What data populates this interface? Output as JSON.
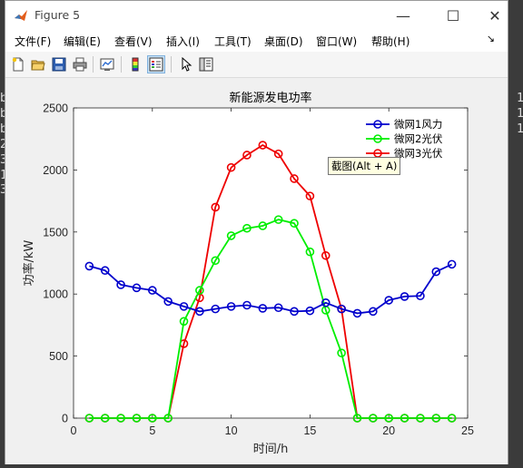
{
  "window": {
    "title": "Figure 5"
  },
  "window_controls": {
    "minimize": "—",
    "maximize": "☐",
    "close": "✕"
  },
  "background_fragments": [
    "b",
    "b",
    "b",
    "2",
    "3",
    "1",
    "3",
    "1",
    "1",
    "1"
  ],
  "menu": [
    {
      "label": "文件(F)"
    },
    {
      "label": "编辑(E)"
    },
    {
      "label": "查看(V)"
    },
    {
      "label": "插入(I)"
    },
    {
      "label": "工具(T)"
    },
    {
      "label": "桌面(D)"
    },
    {
      "label": "窗口(W)"
    },
    {
      "label": "帮助(H)"
    }
  ],
  "menu_overflow": "↘",
  "toolbar": [
    "new-figure-icon",
    "open-folder-icon",
    "save-icon",
    "print-icon",
    "link-plot-icon",
    "colorbar-icon",
    "legend-icon",
    "pointer-arrow-icon",
    "property-inspector-icon"
  ],
  "tooltip": "截图(Alt + A)",
  "colors": {
    "series1": "#0000cc",
    "series2": "#00ee00",
    "series3": "#ee0000"
  },
  "chart_data": {
    "type": "line",
    "title": "新能源发电功率",
    "xlabel": "时间/h",
    "ylabel": "功率/kW",
    "xlim": [
      0,
      25
    ],
    "ylim": [
      0,
      2500
    ],
    "xticks": [
      0,
      5,
      10,
      15,
      20,
      25
    ],
    "yticks": [
      0,
      500,
      1000,
      1500,
      2000,
      2500
    ],
    "grid": false,
    "legend_position": "top-right",
    "x": [
      1,
      2,
      3,
      4,
      5,
      6,
      7,
      8,
      9,
      10,
      11,
      12,
      13,
      14,
      15,
      16,
      17,
      18,
      19,
      20,
      21,
      22,
      23,
      24
    ],
    "series": [
      {
        "name": "微网1风力",
        "color": "#0000cc",
        "marker": "circle",
        "values": [
          1225,
          1190,
          1075,
          1050,
          1030,
          940,
          900,
          860,
          880,
          900,
          910,
          885,
          890,
          860,
          865,
          930,
          880,
          845,
          860,
          950,
          980,
          985,
          1180,
          1240
        ]
      },
      {
        "name": "微网2光伏",
        "color": "#00ee00",
        "marker": "circle",
        "values": [
          0,
          0,
          0,
          0,
          0,
          0,
          780,
          1030,
          1270,
          1470,
          1530,
          1550,
          1600,
          1570,
          1340,
          870,
          525,
          0,
          0,
          0,
          0,
          0,
          0,
          0
        ]
      },
      {
        "name": "微网3光伏",
        "color": "#ee0000",
        "marker": "circle",
        "values": [
          0,
          0,
          0,
          0,
          0,
          0,
          600,
          970,
          1700,
          2020,
          2120,
          2200,
          2130,
          1930,
          1790,
          1310,
          880,
          0,
          0,
          0,
          0,
          0,
          0,
          0
        ]
      }
    ]
  }
}
